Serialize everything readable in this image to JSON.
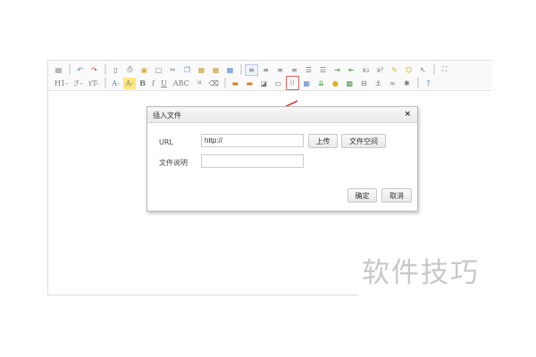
{
  "toolbar": {
    "row1": [
      {
        "n": "source-icon",
        "g": "▤"
      },
      {
        "sep": 1
      },
      {
        "n": "undo-icon",
        "g": "↶",
        "c": "#4a7fc0"
      },
      {
        "n": "redo-icon",
        "g": "↷",
        "c": "#c05050"
      },
      {
        "sep": 1
      },
      {
        "n": "preview-icon",
        "g": "▯"
      },
      {
        "n": "print-icon",
        "g": "⎙"
      },
      {
        "n": "template-icon",
        "g": "▣",
        "c": "#d9b040"
      },
      {
        "n": "new-doc-icon",
        "g": "▢"
      },
      {
        "n": "cut-icon",
        "g": "✂"
      },
      {
        "n": "copy-icon",
        "g": "❐",
        "c": "#5a8ad0"
      },
      {
        "n": "paste-icon",
        "g": "▦",
        "c": "#c9a040"
      },
      {
        "n": "paste-text-icon",
        "g": "▦",
        "c": "#c9a040"
      },
      {
        "n": "paste-word-icon",
        "g": "▦",
        "c": "#5a8ad0"
      },
      {
        "sep": 1
      },
      {
        "n": "align-left-icon",
        "g": "≡",
        "a": 1
      },
      {
        "n": "align-center-icon",
        "g": "≡"
      },
      {
        "n": "align-right-icon",
        "g": "≡"
      },
      {
        "n": "justify-icon",
        "g": "≡"
      },
      {
        "n": "ordered-list-icon",
        "g": "☰"
      },
      {
        "n": "unordered-list-icon",
        "g": "☰"
      },
      {
        "n": "indent-icon",
        "g": "⇥",
        "c": "#4a9a4a"
      },
      {
        "n": "outdent-icon",
        "g": "⇤",
        "c": "#4a9a4a"
      },
      {
        "n": "subscript-icon",
        "g": "x₂"
      },
      {
        "n": "superscript-icon",
        "g": "x²"
      },
      {
        "n": "clear-format-icon",
        "g": "✎",
        "c": "#e0b020"
      },
      {
        "n": "emoticon-icon",
        "g": "☺",
        "c": "#e0b020"
      },
      {
        "n": "select-all-icon",
        "g": "↖"
      },
      {
        "sep": 1
      },
      {
        "n": "fullscreen-icon",
        "g": "⛶"
      }
    ],
    "row2": [
      {
        "n": "heading-button",
        "t": "H1-"
      },
      {
        "n": "font-family-button",
        "t": "ℱ-"
      },
      {
        "n": "font-size-button",
        "t": "тT-"
      },
      {
        "sep": 1
      },
      {
        "n": "font-color-button",
        "t": "A-",
        "c": "#4a7fc0"
      },
      {
        "n": "highlight-color-button",
        "t": "A-",
        "bg": "#ffe680"
      },
      {
        "n": "bold-button",
        "t": "B",
        "b": 1
      },
      {
        "n": "italic-button",
        "t": "I",
        "i": 1
      },
      {
        "n": "underline-button",
        "t": "U",
        "u": 1
      },
      {
        "n": "strikethrough-button",
        "t": "ABC"
      },
      {
        "n": "table-icon",
        "g": "⌗"
      },
      {
        "n": "eraser-icon",
        "g": "⌫"
      },
      {
        "sep": 1
      },
      {
        "n": "link-icon",
        "g": "▬",
        "c": "#d08020"
      },
      {
        "n": "unlink-icon",
        "g": "▬",
        "c": "#d08020"
      },
      {
        "n": "image-icon",
        "g": "◪"
      },
      {
        "n": "video-icon",
        "g": "▭"
      },
      {
        "n": "attachment-icon",
        "g": "⌷",
        "h": 1
      },
      {
        "n": "insert-table-icon",
        "g": "▦",
        "c": "#5a8ad0"
      },
      {
        "n": "horizontal-rule-icon",
        "g": "⇊",
        "c": "#4a9a4a"
      },
      {
        "n": "emotion-icon",
        "g": "●",
        "c": "#e0b020"
      },
      {
        "n": "map-icon",
        "g": "▩",
        "c": "#5a9a5a"
      },
      {
        "n": "page-break-icon",
        "g": "⊟"
      },
      {
        "n": "anchor-icon",
        "g": "⚓"
      },
      {
        "n": "link-chain-icon",
        "g": "∞"
      },
      {
        "n": "spechars-icon",
        "g": "✱"
      },
      {
        "sep": 1
      },
      {
        "n": "help-icon",
        "g": "?",
        "c": "#4a7fc0"
      }
    ]
  },
  "dialog": {
    "title": "插入文件",
    "close": "×",
    "url_label": "URL",
    "url_value": "http://",
    "upload_button": "上传",
    "file_space_button": "文件空间",
    "desc_label": "文件说明",
    "desc_value": "",
    "ok_button": "确定",
    "cancel_button": "取消"
  },
  "watermark": "软件技巧",
  "colors": {
    "arrow": "#d42020",
    "highlight": "#e06060"
  }
}
